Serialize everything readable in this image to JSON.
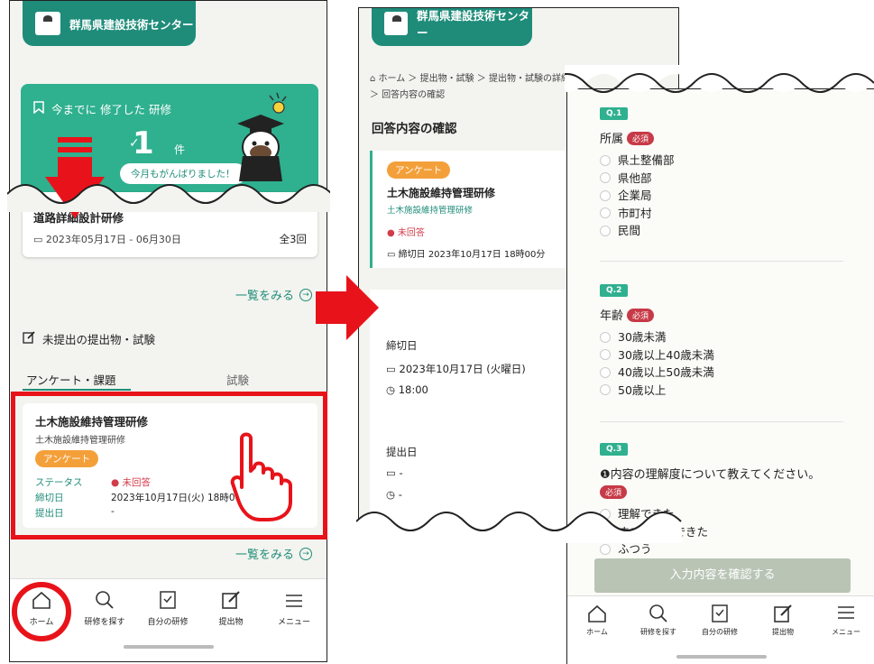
{
  "brand": {
    "name": "群馬県建設技術センター"
  },
  "colors": {
    "accent": "#1f8c7a",
    "hero": "#2fb08f",
    "tag": "#f4a03a",
    "required": "#c73a47",
    "highlight": "#e8131a"
  },
  "phone1": {
    "hero": {
      "heading": "今までに 修了した 研修",
      "count": "1",
      "unit": "件",
      "cheer": "今月もがんばりました！"
    },
    "course": {
      "title": "道路詳細設計研修",
      "dates": "2023年05月17日 - 06月30日",
      "sessions": "全3回"
    },
    "more_label": "一覧をみる",
    "section_title": "未提出の提出物・試験",
    "tabs": [
      "アンケート・課題",
      "試験"
    ],
    "submission": {
      "title": "土木施設維持管理研修",
      "subtitle": "土木施設維持管理研修",
      "tag": "アンケート",
      "status_label": "ステータス",
      "status_value": "未回答",
      "deadline_label": "締切日",
      "deadline_value": "2023年10月17日(火) 18時00分",
      "submitted_label": "提出日",
      "submitted_value": "-"
    }
  },
  "nav": [
    {
      "label": "ホーム",
      "icon": "home-icon"
    },
    {
      "label": "研修を探す",
      "icon": "search-icon"
    },
    {
      "label": "自分の研修",
      "icon": "bookmark-icon"
    },
    {
      "label": "提出物",
      "icon": "edit-icon"
    },
    {
      "label": "メニュー",
      "icon": "menu-icon"
    }
  ],
  "phone2": {
    "breadcrumb_line1": "ホーム ＞ 提出物・試験 ＞ 提出物・試験の詳細",
    "breadcrumb_line2": "＞ 回答内容の確認",
    "title": "回答内容の確認",
    "card": {
      "tag": "アンケート",
      "title": "土木施設維持管理研修",
      "subtitle": "土木施設維持管理研修",
      "status": "未回答",
      "deadline": "締切日  2023年10月17日 18時00分"
    },
    "deadline_heading": "締切日",
    "deadline_date": "2023年10月17日 (火曜日)",
    "deadline_time": "18:00",
    "submitted_heading": "提出日",
    "submitted_date": "-",
    "submitted_time": "-"
  },
  "phone3": {
    "questions": [
      {
        "badge": "Q.1",
        "text": "所属",
        "required": "必須",
        "options": [
          "県土整備部",
          "県他部",
          "企業局",
          "市町村",
          "民間"
        ]
      },
      {
        "badge": "Q.2",
        "text": "年齢",
        "required": "必須",
        "options": [
          "30歳未満",
          "30歳以上40歳未満",
          "40歳以上50歳未満",
          "50歳以上"
        ]
      },
      {
        "badge": "Q.3",
        "text": "❶内容の理解度について教えてください。",
        "required": "必須",
        "options": [
          "理解できた",
          "すこし理解できた",
          "ふつう"
        ]
      }
    ],
    "confirm_label": "入力内容を確認する"
  }
}
